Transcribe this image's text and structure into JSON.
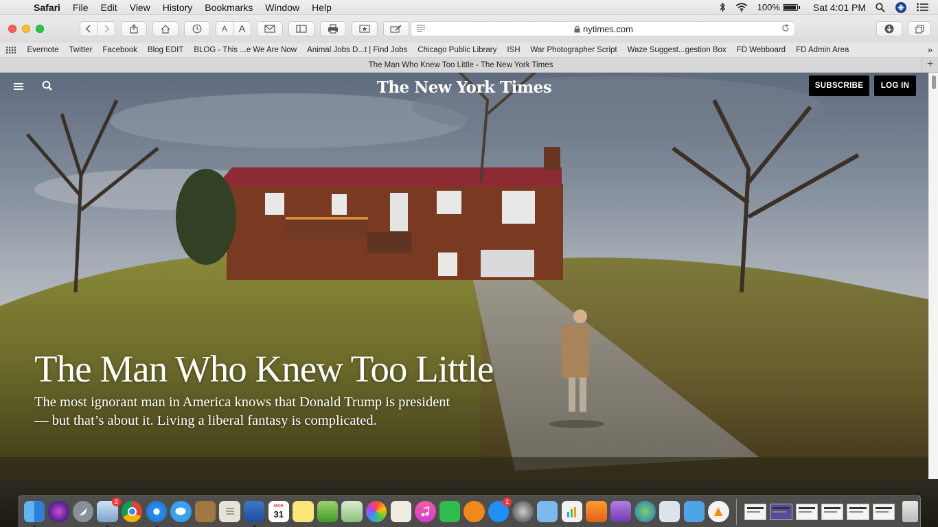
{
  "menubar": {
    "app": "Safari",
    "items": [
      "File",
      "Edit",
      "View",
      "History",
      "Bookmarks",
      "Window",
      "Help"
    ],
    "battery_percent": "100%",
    "battery_level": 1.0,
    "clock": "Sat 4:01 PM"
  },
  "toolbar": {
    "url": "nytimes.com",
    "font_smaller": "A",
    "font_larger": "A"
  },
  "bookmarks": [
    "Evernote",
    "Twitter",
    "Facebook",
    "Blog EDIT",
    "BLOG - This ...e We Are Now",
    "Animal Jobs D...t | Find Jobs",
    "Chicago Public Library",
    "ISH",
    "War Photographer Script",
    "Waze Suggest...gestion Box",
    "FD Webboard",
    "FD Admin Area"
  ],
  "bookmarks_more": "»",
  "tab": {
    "title": "The Man Who Knew Too Little - The New York Times",
    "new_tab": "+"
  },
  "nyt": {
    "logo": "The New York Times",
    "subscribe": "SUBSCRIBE",
    "login": "LOG IN",
    "headline": "The Man Who Knew Too Little",
    "dek": "The most ignorant man in America knows that Donald Trump is president — but that’s about it. Living a liberal fantasy is complicated."
  },
  "dock": {
    "calendar_month": "MAR",
    "calendar_day": "31",
    "badges": {
      "preview": "2",
      "appstore": "1"
    }
  },
  "colors": {
    "nyt_button": "#000000",
    "roof": "#8b2a32",
    "brick": "#7a3a22"
  }
}
